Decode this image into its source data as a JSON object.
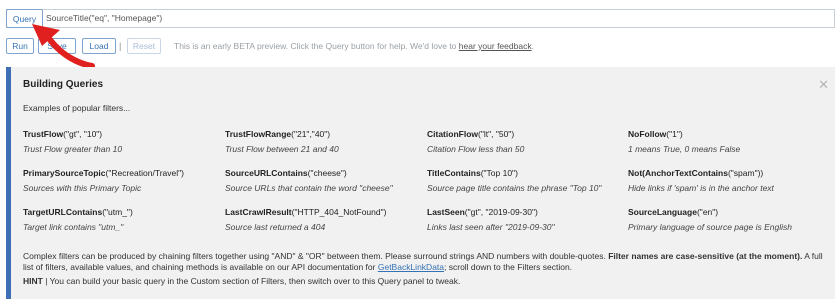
{
  "query": {
    "button_label": "Query",
    "input_value": "SourceTitle(\"eq\",  \"Homepage\")"
  },
  "toolbar": {
    "run_label": "Run",
    "save_label": "Save",
    "load_label": "Load",
    "separator": "|",
    "reset_label": "Reset",
    "beta_text": "This is an early BETA preview. Click the Query button for help. We'd love to",
    "feedback_link": "hear your feedback",
    "beta_suffix": "."
  },
  "panel": {
    "title": "Building Queries",
    "close_icon": "close-icon",
    "intro": "Examples of popular filters...",
    "filters": [
      {
        "name": "TrustFlow",
        "args": "(\"gt\", \"10\")",
        "desc": "Trust Flow greater than 10"
      },
      {
        "name": "TrustFlowRange",
        "args": "(\"21\",\"40\")",
        "desc": "Trust Flow between 21 and 40"
      },
      {
        "name": "CitationFlow",
        "args": "(\"lt\", \"50\")",
        "desc": "Citation Flow less than 50"
      },
      {
        "name": "NoFollow",
        "args": "(\"1\")",
        "desc": "1 means True, 0 means False"
      },
      {
        "name": "PrimarySourceTopic",
        "args": "(\"Recreation/Travel\")",
        "desc": "Sources with this Primary Topic"
      },
      {
        "name": "SourceURLContains",
        "args": "(\"cheese\")",
        "desc": "Source URLs that contain the word \"cheese\""
      },
      {
        "name": "TitleContains",
        "args": "(\"Top 10\")",
        "desc": "Source page title contains the phrase \"Top 10\""
      },
      {
        "name": "Not(AnchorTextContains",
        "args": "(\"spam\"))",
        "desc": "Hide links if 'spam' is in the anchor text"
      },
      {
        "name": "TargetURLContains",
        "args": "(\"utm_\")",
        "desc": "Target link contains \"utm_\""
      },
      {
        "name": "LastCrawlResult",
        "args": "(\"HTTP_404_NotFound\")",
        "desc": "Source last returned a 404"
      },
      {
        "name": "LastSeen",
        "args": "(\"gt\", \"2019-09-30\")",
        "desc": "Links last seen after \"2019-09-30\""
      },
      {
        "name": "SourceLanguage",
        "args": "(\"en\")",
        "desc": "Primary language of source page is English"
      }
    ],
    "note_part1": "Complex filters can be produced by chaining filters together using \"AND\" & \"OR\" between them. Please surround strings AND numbers with double-quotes.",
    "note_bold": "Filter names are case-sensitive (at the moment).",
    "note_part2": "A full list of filters, available values, and chaining methods is available on our API documentation for",
    "note_link": "GetBackLinkData",
    "note_part3": "; scroll down to the Filters section.",
    "hint_label": "HINT",
    "hint_text": "| You can build your basic query in the Custom section of Filters, then switch over to this Query panel to tweak."
  },
  "colors": {
    "accent": "#3e6eb3",
    "arrow": "#e0201f",
    "panel_bg": "#f1f1f1"
  }
}
